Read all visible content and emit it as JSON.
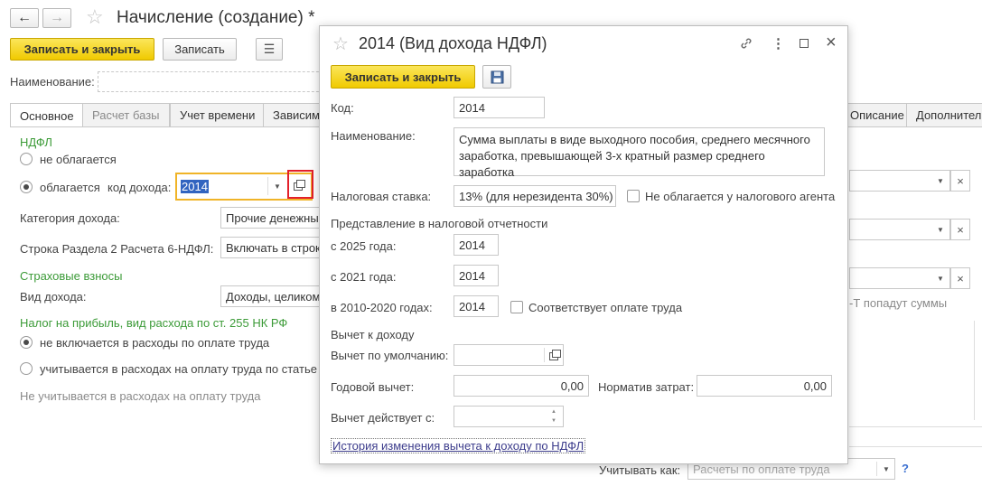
{
  "window": {
    "title": "Начисление (создание) *",
    "nav_back": "←",
    "nav_forward": "→"
  },
  "toolbar": {
    "save_close_label": "Записать и закрыть",
    "save_label": "Записать"
  },
  "form": {
    "name_label": "Наименование:",
    "tabs": [
      {
        "label": "Основное",
        "state": "active"
      },
      {
        "label": "Расчет базы",
        "state": "disabled"
      },
      {
        "label": "Учет времени",
        "state": "normal"
      },
      {
        "label": "Зависим",
        "state": "normal"
      },
      {
        "label": "Описание",
        "state": "normal"
      },
      {
        "label": "Дополнитель",
        "state": "normal"
      }
    ],
    "ndfl_section": "НДФЛ",
    "radio_not_taxed": "не облагается",
    "radio_taxed": "облагается",
    "income_code_label": "код дохода:",
    "income_code_value": "2014",
    "income_category_label": "Категория дохода:",
    "income_category_value": "Прочие денежны",
    "report_line_label": "Строка Раздела 2 Расчета 6-НДФЛ:",
    "report_line_value": "Включать в строк",
    "insurance_section": "Страховые взносы",
    "income_kind_label": "Вид дохода:",
    "income_kind_value": "Доходы, целиком",
    "profit_tax_section": "Налог на прибыль, вид расхода по ст. 255 НК РФ",
    "radio_not_included": "не включается в расходы по оплате труда",
    "radio_included": "учитывается в расходах на оплату труда по статье",
    "profit_tax_note": "Не учитывается в расходах на оплату труда",
    "right_note": "-Т попадут суммы",
    "account_as_label": "Учитывать как:",
    "account_as_placeholder": "Расчеты по оплате труда",
    "help": "?"
  },
  "dialog": {
    "title": "2014 (Вид дохода НДФЛ)",
    "save_close_label": "Записать и закрыть",
    "code_label": "Код:",
    "code_value": "2014",
    "name_label": "Наименование:",
    "name_value": "Сумма выплаты в виде выходного пособия, среднего месячного заработка, превышающей 3-х кратный размер среднего заработка",
    "tax_rate_label": "Налоговая ставка:",
    "tax_rate_value": "13% (для нерезидента 30%)",
    "not_taxed_agent_label": "Не облагается у налогового агента",
    "reporting_section": "Представление в налоговой отчетности",
    "from_2025_label": "с 2025 года:",
    "from_2025_value": "2014",
    "from_2021_label": "с 2021 года:",
    "from_2021_value": "2014",
    "years_2010_2020_label": "в 2010-2020 годах:",
    "years_2010_2020_value": "2014",
    "labor_payment_label": "Соответствует оплате труда",
    "deduction_section": "Вычет к доходу",
    "default_deduction_label": "Вычет по умолчанию:",
    "default_deduction_value": "",
    "annual_deduction_label": "Годовой вычет:",
    "annual_deduction_value": "0,00",
    "cost_norm_label": "Норматив затрат:",
    "cost_norm_value": "0,00",
    "deduction_valid_label": "Вычет действует с:",
    "deduction_valid_value": "",
    "history_link": "История изменения вычета к доходу по НДФЛ"
  },
  "colors": {
    "accent_yellow": "#f5d426",
    "section_green": "#3c9b38",
    "highlight_red": "#e3202a",
    "field_focus_orange": "#f0b428",
    "selection_blue": "#3164c0"
  }
}
